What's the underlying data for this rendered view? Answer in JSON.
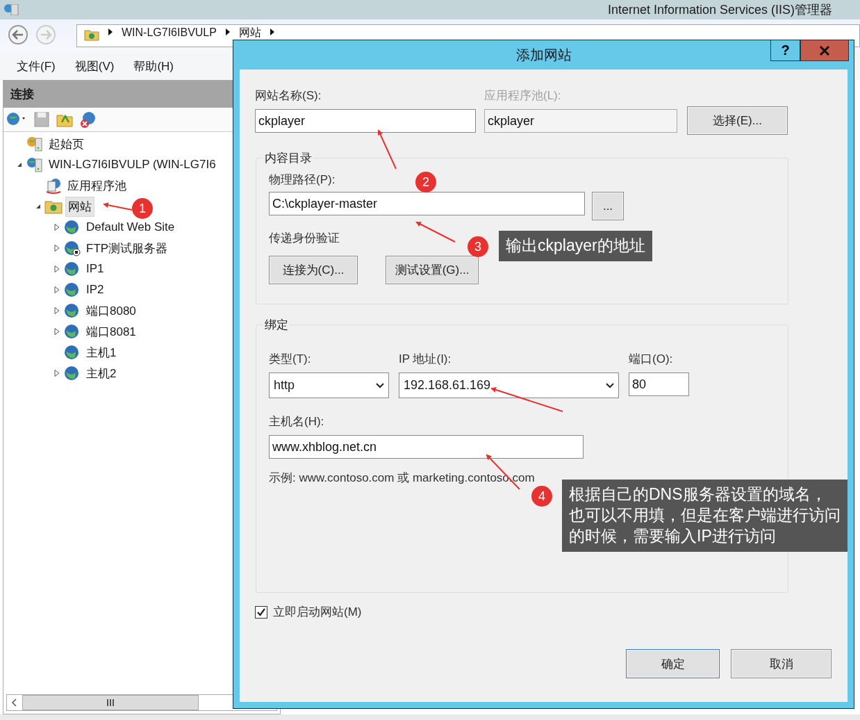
{
  "window": {
    "title": "Internet Information Services (IIS)管理器"
  },
  "address_bar": {
    "segments": [
      "WIN-LG7I6IBVULP",
      "网站"
    ]
  },
  "menu": [
    "文件(F)",
    "视图(V)",
    "帮助(H)"
  ],
  "connections": {
    "title": "连接",
    "tree": [
      {
        "label": "起始页",
        "kind": "start",
        "selected": false
      },
      {
        "label": "WIN-LG7I6IBVULP (WIN-LG7I6",
        "kind": "server",
        "selected": false,
        "expanded": true,
        "children": [
          {
            "label": "应用程序池",
            "kind": "pool",
            "selected": false
          },
          {
            "label": "网站",
            "kind": "sites",
            "selected": true,
            "expanded": true,
            "children": [
              {
                "label": "Default Web Site",
                "kind": "web",
                "selected": false,
                "expanded": false
              },
              {
                "label": "FTP测试服务器",
                "kind": "ftp",
                "selected": false,
                "expanded": false
              },
              {
                "label": "IP1",
                "kind": "web",
                "selected": false,
                "expanded": false
              },
              {
                "label": "IP2",
                "kind": "web",
                "selected": false,
                "expanded": false
              },
              {
                "label": "端口8080",
                "kind": "web",
                "selected": false,
                "expanded": false
              },
              {
                "label": "端口8081",
                "kind": "web",
                "selected": false,
                "expanded": false
              },
              {
                "label": "主机1",
                "kind": "web",
                "selected": false
              },
              {
                "label": "主机2",
                "kind": "web",
                "selected": false,
                "expanded": false
              }
            ]
          }
        ]
      }
    ]
  },
  "dialog": {
    "title": "添加网站",
    "help_button": "?",
    "site_name": {
      "label": "网站名称(S):",
      "value": "ckplayer"
    },
    "app_pool": {
      "label": "应用程序池(L):",
      "value": "ckplayer",
      "disabled": true
    },
    "select_button": "选择(E)...",
    "content_directory": {
      "title": "内容目录",
      "physical_path": {
        "label": "物理路径(P):",
        "value": "C:\\ckplayer-master"
      },
      "browse_button": "...",
      "pass_through_label": "传递身份验证",
      "connect_button": "连接为(C)...",
      "test_button": "测试设置(G)..."
    },
    "binding": {
      "title": "绑定",
      "type": {
        "label": "类型(T):",
        "value": "http"
      },
      "ip": {
        "label": "IP 地址(I):",
        "value": "192.168.61.169"
      },
      "port": {
        "label": "端口(O):",
        "value": "80"
      },
      "host_name": {
        "label": "主机名(H):",
        "value": "www.xhblog.net.cn"
      },
      "example": "示例: www.contoso.com 或 marketing.contoso.com"
    },
    "start_immediately": {
      "label": "立即启动网站(M)",
      "checked": true
    },
    "ok_button": "确定",
    "cancel_button": "取消"
  },
  "annotations": [
    {
      "number": "1"
    },
    {
      "number": "2"
    },
    {
      "number": "3",
      "lines": [
        "输出ckplayer的地址"
      ]
    },
    {
      "number": "4",
      "lines": [
        "根据自己的DNS服务器设置的域名，",
        "也可以不用填，但是在客户端进行访问",
        "的时候，需要输入IP进行访问"
      ]
    }
  ]
}
